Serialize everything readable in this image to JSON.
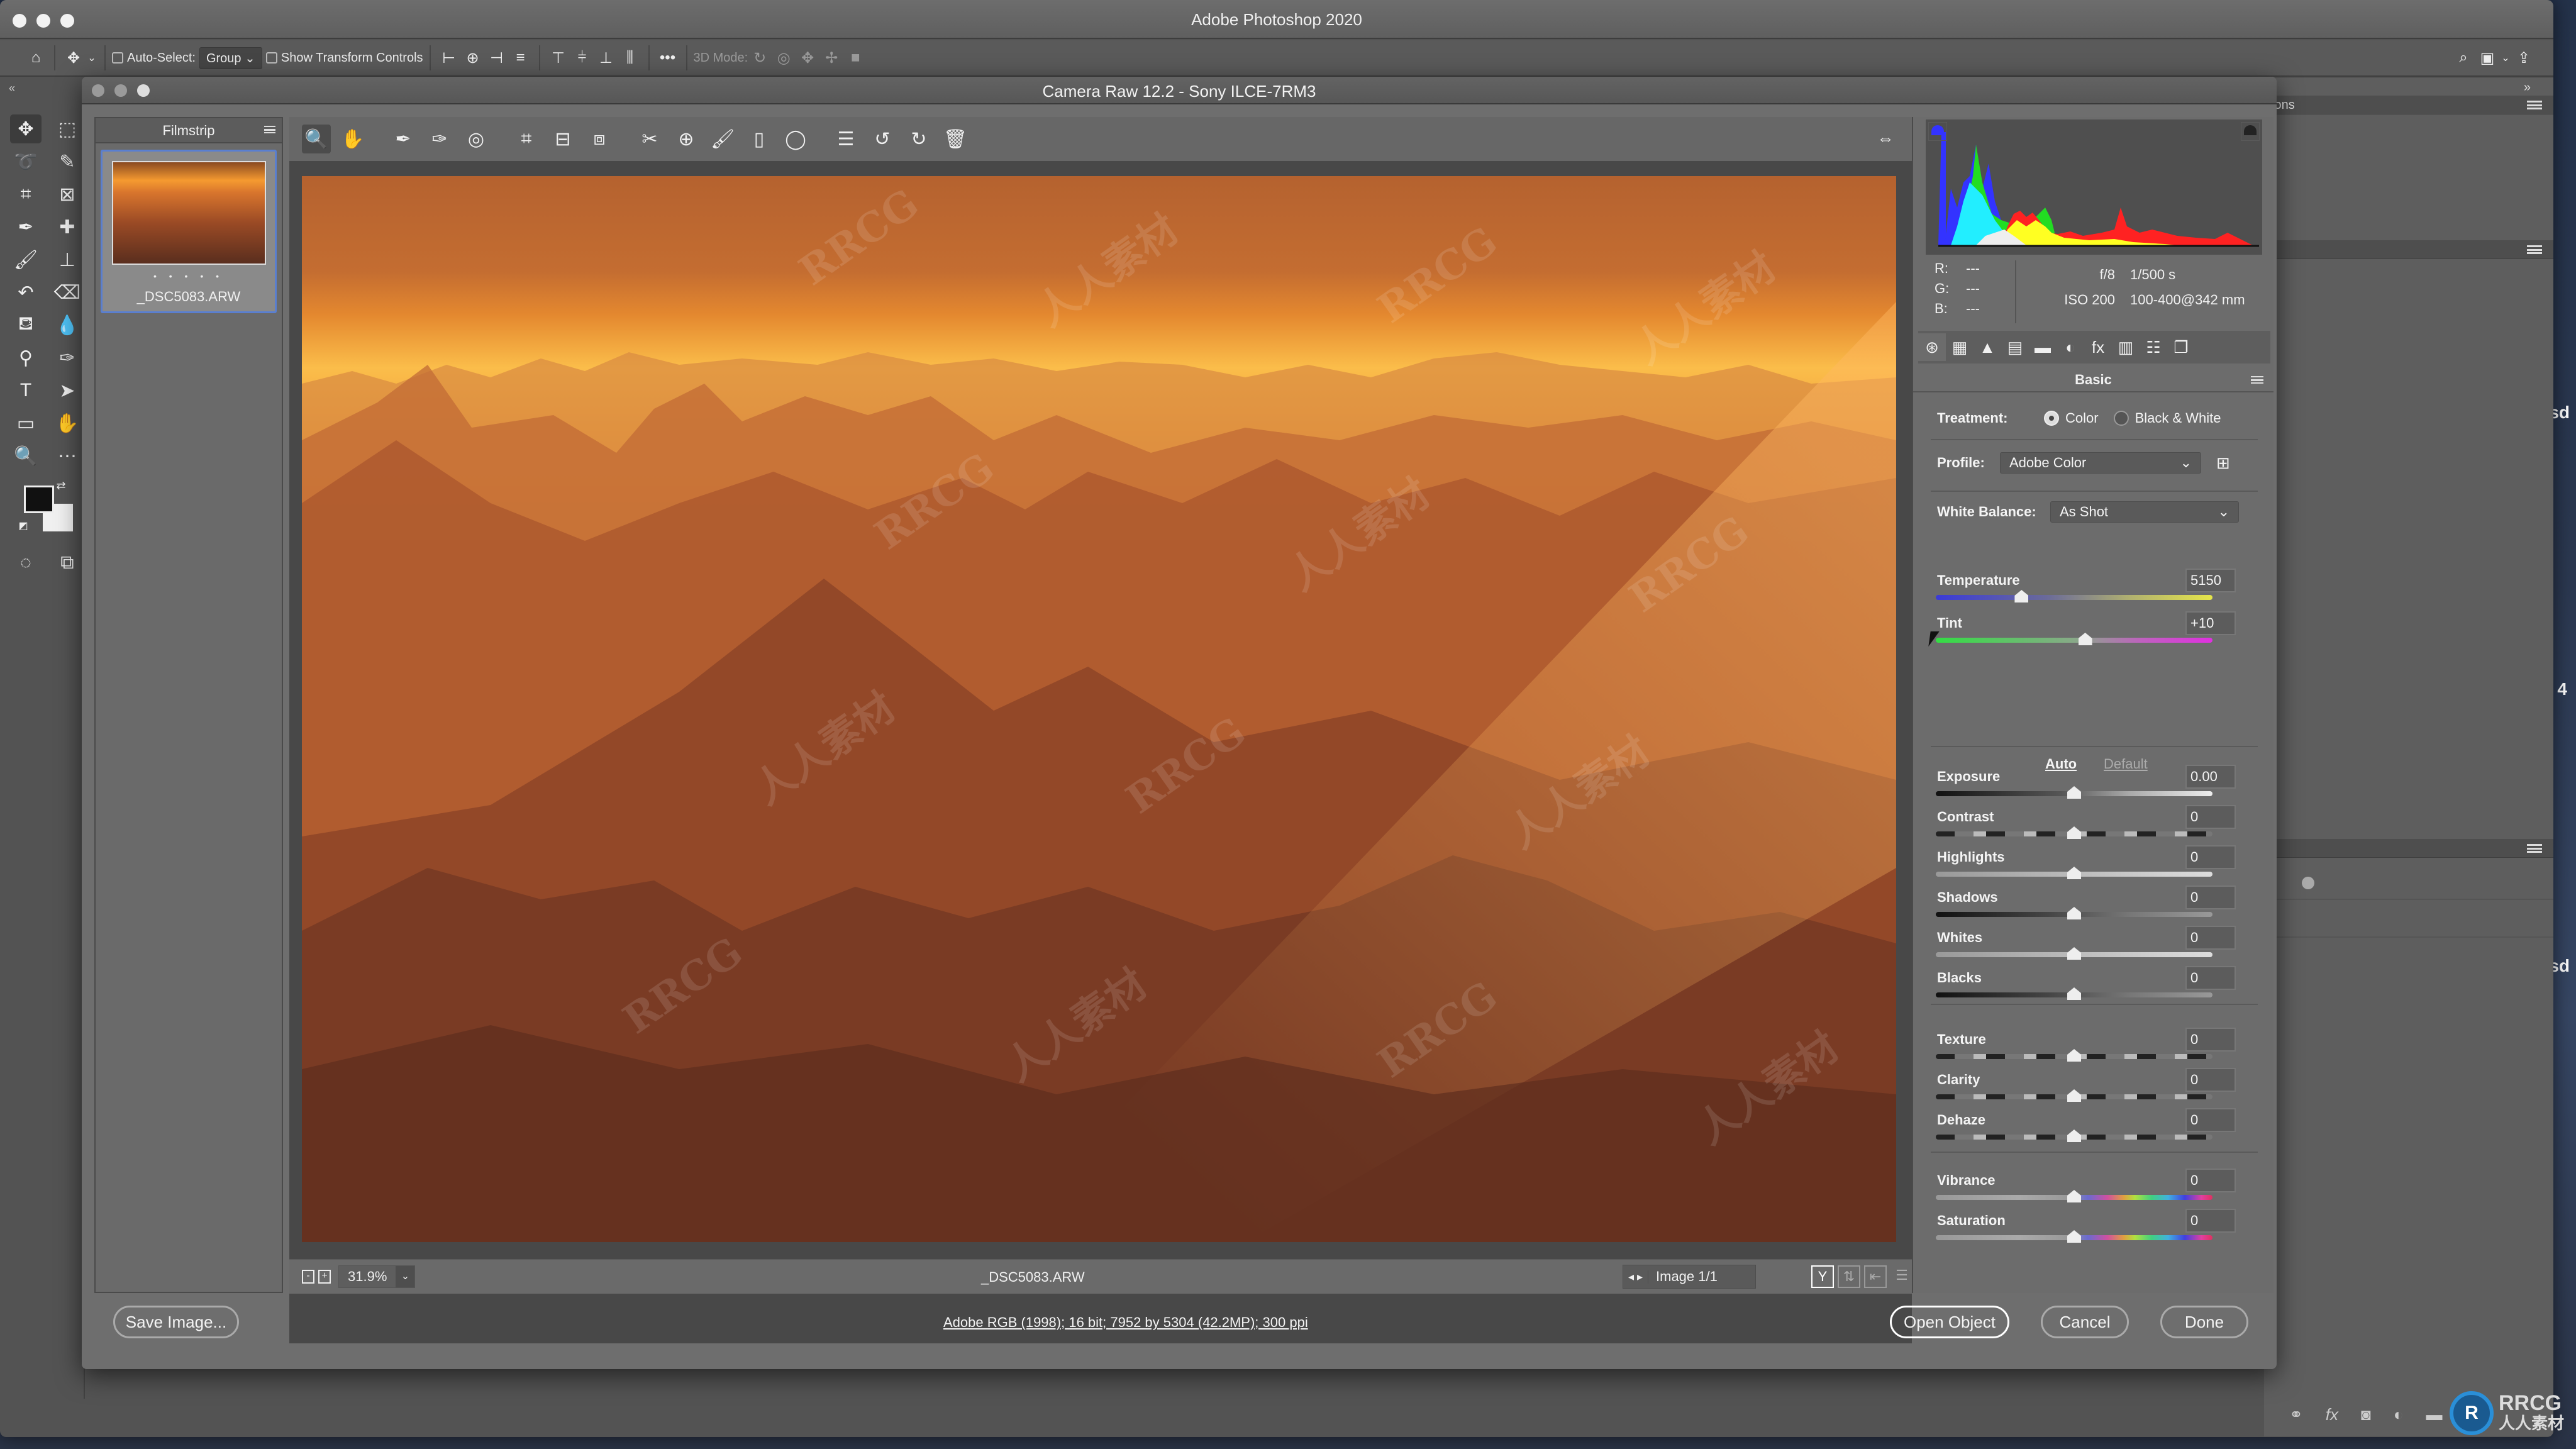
{
  "app": {
    "title": "Adobe Photoshop 2020",
    "options_bar": {
      "home_icon": "home-icon",
      "move_tool_icon": "move-icon",
      "auto_select_label": "Auto-Select:",
      "auto_select_checked": false,
      "auto_select_mode": "Group",
      "show_transform_label": "Show Transform Controls",
      "show_transform_checked": false,
      "more_label": "•••",
      "mode_3d_label": "3D Mode:",
      "search_icon": "search-icon",
      "workspace_icon": "workspace-icon",
      "share_icon": "share-icon"
    },
    "tools_collapse": "«",
    "right_panel": {
      "partial_tab_label": "ions",
      "collapse": "»"
    },
    "desktop_labels": [
      "sd",
      "4",
      "sd"
    ]
  },
  "camera_raw": {
    "title": "Camera Raw 12.2  -  Sony ILCE-7RM3",
    "filmstrip": {
      "title": "Filmstrip",
      "items": [
        {
          "name": "_DSC5083.ARW",
          "rating": "• • • • •",
          "selected": true
        }
      ]
    },
    "toolbar": {
      "tools": [
        {
          "name": "zoom-tool",
          "glyph": "🔍",
          "active": true
        },
        {
          "name": "hand-tool",
          "glyph": "✋"
        },
        {
          "name": "white-balance-tool",
          "glyph": "✒"
        },
        {
          "name": "color-sampler-tool",
          "glyph": "✑"
        },
        {
          "name": "targeted-adjustment-tool",
          "glyph": "◎"
        },
        {
          "name": "crop-tool",
          "glyph": "⌗"
        },
        {
          "name": "straighten-tool",
          "glyph": "⊟"
        },
        {
          "name": "transform-tool",
          "glyph": "⧈"
        },
        {
          "name": "spot-removal-tool",
          "glyph": "✂"
        },
        {
          "name": "red-eye-tool",
          "glyph": "⊕"
        },
        {
          "name": "adjustment-brush-tool",
          "glyph": "🖌"
        },
        {
          "name": "graduated-filter-tool",
          "glyph": "▯"
        },
        {
          "name": "radial-filter-tool",
          "glyph": "◯"
        },
        {
          "name": "preferences-icon",
          "glyph": "☰"
        },
        {
          "name": "rotate-ccw-icon",
          "glyph": "↺"
        },
        {
          "name": "rotate-cw-icon",
          "glyph": "↻"
        },
        {
          "name": "trash-icon",
          "glyph": "🗑"
        }
      ]
    },
    "preview": {
      "zoom_level": "31.9%",
      "file_name": "_DSC5083.ARW",
      "image_count": "Image 1/1",
      "watermarks": [
        "RRCG",
        "人人素材"
      ]
    },
    "histogram": {
      "r": "---",
      "g": "---",
      "b": "---",
      "aperture": "f/8",
      "shutter": "1/500 s",
      "iso": "ISO 200",
      "lens": "100-400@342 mm"
    },
    "panel_tabs": [
      {
        "name": "basic-tab",
        "glyph": "⊛",
        "active": true
      },
      {
        "name": "tone-curve-tab",
        "glyph": "▦"
      },
      {
        "name": "detail-tab",
        "glyph": "▲"
      },
      {
        "name": "hsl-tab",
        "glyph": "▤"
      },
      {
        "name": "split-toning-tab",
        "glyph": "▬"
      },
      {
        "name": "lens-corrections-tab",
        "glyph": "◐"
      },
      {
        "name": "effects-tab",
        "glyph": "fx"
      },
      {
        "name": "calibration-tab",
        "glyph": "▥"
      },
      {
        "name": "presets-tab",
        "glyph": "☷"
      },
      {
        "name": "snapshots-tab",
        "glyph": "❐"
      }
    ],
    "basic": {
      "title": "Basic",
      "treatment_label": "Treatment:",
      "treatment_options": [
        "Color",
        "Black & White"
      ],
      "treatment_selected": "Color",
      "profile_label": "Profile:",
      "profile_value": "Adobe Color",
      "white_balance_label": "White Balance:",
      "white_balance_value": "As Shot",
      "auto_label": "Auto",
      "default_label": "Default",
      "sliders": [
        {
          "label": "Temperature",
          "value": "5150",
          "position": 0.31,
          "track": "temp"
        },
        {
          "label": "Tint",
          "value": "+10",
          "position": 0.54,
          "track": "tint"
        },
        {
          "label": "Exposure",
          "value": "0.00",
          "position": 0.5,
          "track": "exposure"
        },
        {
          "label": "Contrast",
          "value": "0",
          "position": 0.5,
          "track": "contrast"
        },
        {
          "label": "Highlights",
          "value": "0",
          "position": 0.5,
          "track": "light"
        },
        {
          "label": "Shadows",
          "value": "0",
          "position": 0.5,
          "track": "dark"
        },
        {
          "label": "Whites",
          "value": "0",
          "position": 0.5,
          "track": "light"
        },
        {
          "label": "Blacks",
          "value": "0",
          "position": 0.5,
          "track": "dark"
        },
        {
          "label": "Texture",
          "value": "0",
          "position": 0.5,
          "track": "contrast"
        },
        {
          "label": "Clarity",
          "value": "0",
          "position": 0.5,
          "track": "contrast"
        },
        {
          "label": "Dehaze",
          "value": "0",
          "position": 0.5,
          "track": "contrast"
        },
        {
          "label": "Vibrance",
          "value": "0",
          "position": 0.5,
          "track": "rainbow"
        },
        {
          "label": "Saturation",
          "value": "0",
          "position": 0.5,
          "track": "rainbow"
        }
      ]
    },
    "bottom": {
      "save_image": "Save Image...",
      "workflow_info": "Adobe RGB (1998); 16 bit; 7952 by 5304 (42.2MP); 300 ppi",
      "open_object": "Open Object",
      "cancel": "Cancel",
      "done": "Done"
    }
  },
  "watermark_logo": {
    "line1": "RRCG",
    "line2": "人人素材"
  }
}
